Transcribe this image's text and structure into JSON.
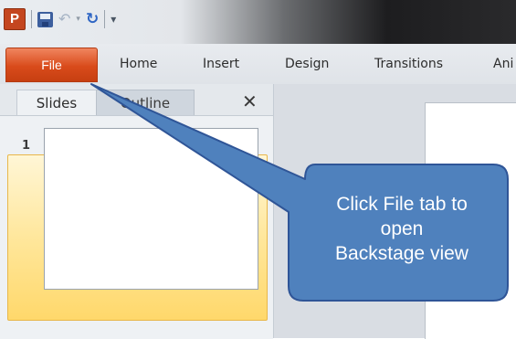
{
  "app": {
    "logo_letter": "P"
  },
  "quick_access": {
    "save_icon": "save-icon",
    "undo_icon": "undo-icon",
    "redo_icon": "redo-icon",
    "customize_icon": "customize-icon"
  },
  "ribbon": {
    "tabs": [
      {
        "label": "File",
        "active": true,
        "color": "#d94b1b"
      },
      {
        "label": "Home"
      },
      {
        "label": "Insert"
      },
      {
        "label": "Design"
      },
      {
        "label": "Transitions"
      },
      {
        "label": "Ani"
      }
    ]
  },
  "left_pane": {
    "tabs": [
      {
        "label": "Slides",
        "selected": true
      },
      {
        "label": "Outline",
        "selected": false
      }
    ],
    "close_icon": "close-icon",
    "slides": [
      {
        "number": "1"
      }
    ]
  },
  "callout": {
    "lines": [
      "Click File tab to",
      "open",
      "Backstage view"
    ],
    "fill": "#4f81bd",
    "border": "#2f5597"
  }
}
